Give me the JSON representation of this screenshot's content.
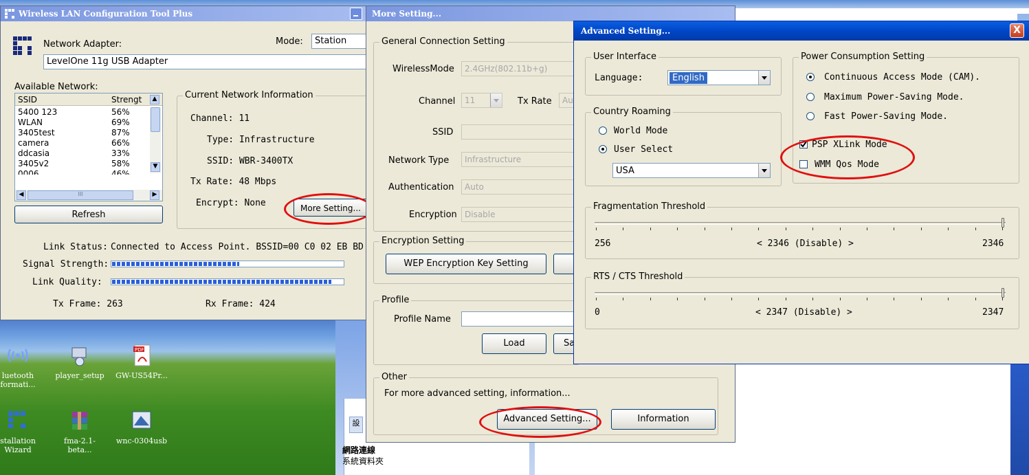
{
  "desktop": {
    "icons": [
      {
        "label_line1": "luetooth",
        "label_line2": "formati...",
        "icon": "bluetooth-icon"
      },
      {
        "label_line1": "player_setup",
        "label_line2": "",
        "icon": "installer-icon"
      },
      {
        "label_line1": "GW-US54Pr...",
        "label_line2": "",
        "icon": "pdf-icon",
        "badge": "PDF"
      },
      {
        "label_line1": "stallation",
        "label_line2": "Wizard",
        "icon": "levelone-icon"
      },
      {
        "label_line1": "fma-2.1-beta...",
        "label_line2": "",
        "icon": "winrar-icon"
      },
      {
        "label_line1": "wnc-0304usb",
        "label_line2": "",
        "icon": "setup-icon"
      }
    ],
    "explorer": {
      "tab": "設",
      "title": "網路連線",
      "subtitle": "系統資料夾"
    }
  },
  "main_window": {
    "title": "Wireless LAN Configuration Tool Plus",
    "adapter_label": "Network Adapter:",
    "adapter_value": "LevelOne 11g USB Adapter",
    "mode_label": "Mode:",
    "mode_value": "Station",
    "available_label": "Available Network:",
    "columns": [
      "SSID",
      "Strengt"
    ],
    "networks": [
      {
        "ssid": "5400 123",
        "strength": "56%"
      },
      {
        "ssid": "WLAN",
        "strength": "69%"
      },
      {
        "ssid": "3405test",
        "strength": "87%"
      },
      {
        "ssid": "camera",
        "strength": "66%"
      },
      {
        "ssid": "ddcasia",
        "strength": "33%"
      },
      {
        "ssid": "3405v2",
        "strength": "58%"
      },
      {
        "ssid": "0006",
        "strength": "46%"
      }
    ],
    "scroll_mid": "III",
    "refresh": "Refresh",
    "current_group": "Current Network Information",
    "channel": "Channel: 11",
    "type": "Type: Infrastructure",
    "ssid": "SSID: WBR-3400TX",
    "tx_rate": "Tx Rate: 48 Mbps",
    "encrypt": "Encrypt: None",
    "more_setting": "More Setting...",
    "link_status_label": "Link Status:",
    "link_status_value": "Connected to Access Point. BSSID=00 C0 02 EB BD",
    "signal_label": "Signal Strength:",
    "signal_level": 0.55,
    "quality_label": "Link Quality:",
    "quality_level": 0.95,
    "tx_frame": "Tx Frame: 263",
    "rx_frame": "Rx Frame: 424"
  },
  "more_window": {
    "title": "More Setting...",
    "general_group": "General Connection Setting",
    "wireless_mode_label": "WirelessMode",
    "wireless_mode_value": "2.4GHz(802.11b+g)",
    "channel_label": "Channel",
    "channel_value": "11",
    "tx_rate_label": "Tx Rate",
    "tx_rate_value": "Au",
    "ssid_label": "SSID",
    "network_type_label": "Network Type",
    "network_type_value": "Infrastructure",
    "auth_label": "Authentication",
    "auth_value": "Auto",
    "encryption_label": "Encryption",
    "encryption_value": "Disable",
    "enc_group": "Encryption Setting",
    "wep_button": "WEP Encryption Key Setting",
    "profile_group": "Profile",
    "profile_name_label": "Profile Name",
    "load_button": "Load",
    "save_button": "Sa",
    "other_group": "Other",
    "other_text": "For more advanced setting, information...",
    "advanced_button": "Advanced Setting...",
    "info_button": "Information"
  },
  "advanced_window": {
    "title": "Advanced Setting...",
    "ui_group": "User Interface",
    "language_label": "Language:",
    "language_value": "English",
    "roaming_group": "Country Roaming",
    "world_mode": "World Mode",
    "user_select": "User Select",
    "country_value": "USA",
    "power_group": "Power Consumption Setting",
    "cam": "Continuous Access Mode (CAM).",
    "max_psm": "Maximum Power-Saving Mode.",
    "fast_psm": "Fast Power-Saving Mode.",
    "psp_xlink": "PSP XLink Mode",
    "wmm_qos": "WMM Qos Mode",
    "frag_group": "Fragmentation Threshold",
    "frag_min": "256",
    "frag_value": "< 2346 (Disable) >",
    "frag_max": "2346",
    "rts_group": "RTS / CTS Threshold",
    "rts_min": "0",
    "rts_value": "< 2347 (Disable) >",
    "rts_max": "2347",
    "close_glyph": "X"
  },
  "colors": {
    "annotation": "#e01010",
    "title_active": "#0046c8",
    "title_inactive": "#7a96df"
  }
}
